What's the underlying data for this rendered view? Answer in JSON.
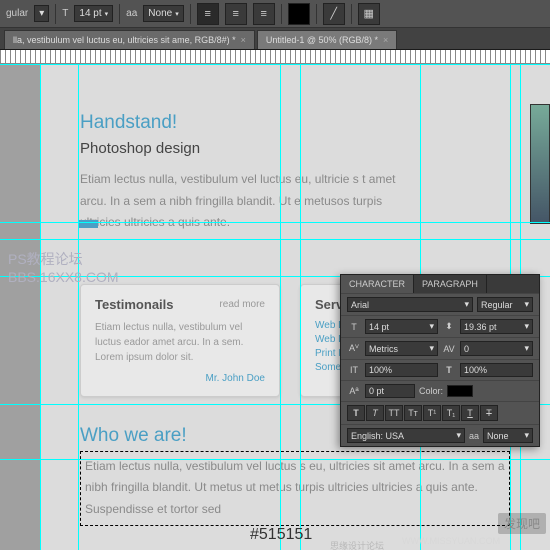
{
  "toolbar": {
    "left_label": "gular",
    "fontsize": "14 pt",
    "aa_label": "aa",
    "aa_value": "None"
  },
  "tabs": [
    {
      "label": "lla, vestibulum vel luctus eu, ultricies sit ame, RGB/8#) *"
    },
    {
      "label": "Untitled-1 @ 50% (RGB/8) *"
    }
  ],
  "doc": {
    "h1": "Handstand!",
    "h2": "Photoshop design",
    "body": "Etiam lectus nulla, vestibulum vel luctus eu, ultricie s t amet arcu. In a sem a nibh fringilla blandit. Ut e metusos turpis ultricies ultricies a quis ante.",
    "testimonials": {
      "title": "Testimonails",
      "more": "read more",
      "body": "Etiam lectus nulla, vestibulum vel luctus eador amet arcu. In a sem. Lorem ipsum dolor sit.",
      "author": "Mr. John Doe"
    },
    "services": {
      "title": "Servic",
      "links": [
        "Web De",
        "Web De",
        "Print De",
        "Some L"
      ]
    },
    "who_title": "Who we are!",
    "who_body": "Etiam lectus nulla, vestibulum vel luctus s eu, ultricies sit amet arcu. In a sem a nibh fringilla blandit. Ut metus ut metus turpis ultricies ultricies a quis ante. Suspendisse et tortor sed"
  },
  "hex": "#515151",
  "char": {
    "tabs": [
      "CHARACTER",
      "PARAGRAPH"
    ],
    "font": "Arial",
    "style": "Regular",
    "size": "14 pt",
    "leading": "19.36 pt",
    "kerning": "Metrics",
    "tracking": "0",
    "vscale": "100%",
    "hscale": "100%",
    "baseline": "0 pt",
    "color_label": "Color:",
    "lang": "English: USA",
    "aa": "None",
    "aa_prefix": "aa"
  },
  "wm": {
    "w1a": "PS教程论坛",
    "w1b": "BBS.16XX8.COM",
    "w2": "WWW.MISSYUAN.COM",
    "w3": "发现吧",
    "w4": "思缘设计论坛"
  }
}
